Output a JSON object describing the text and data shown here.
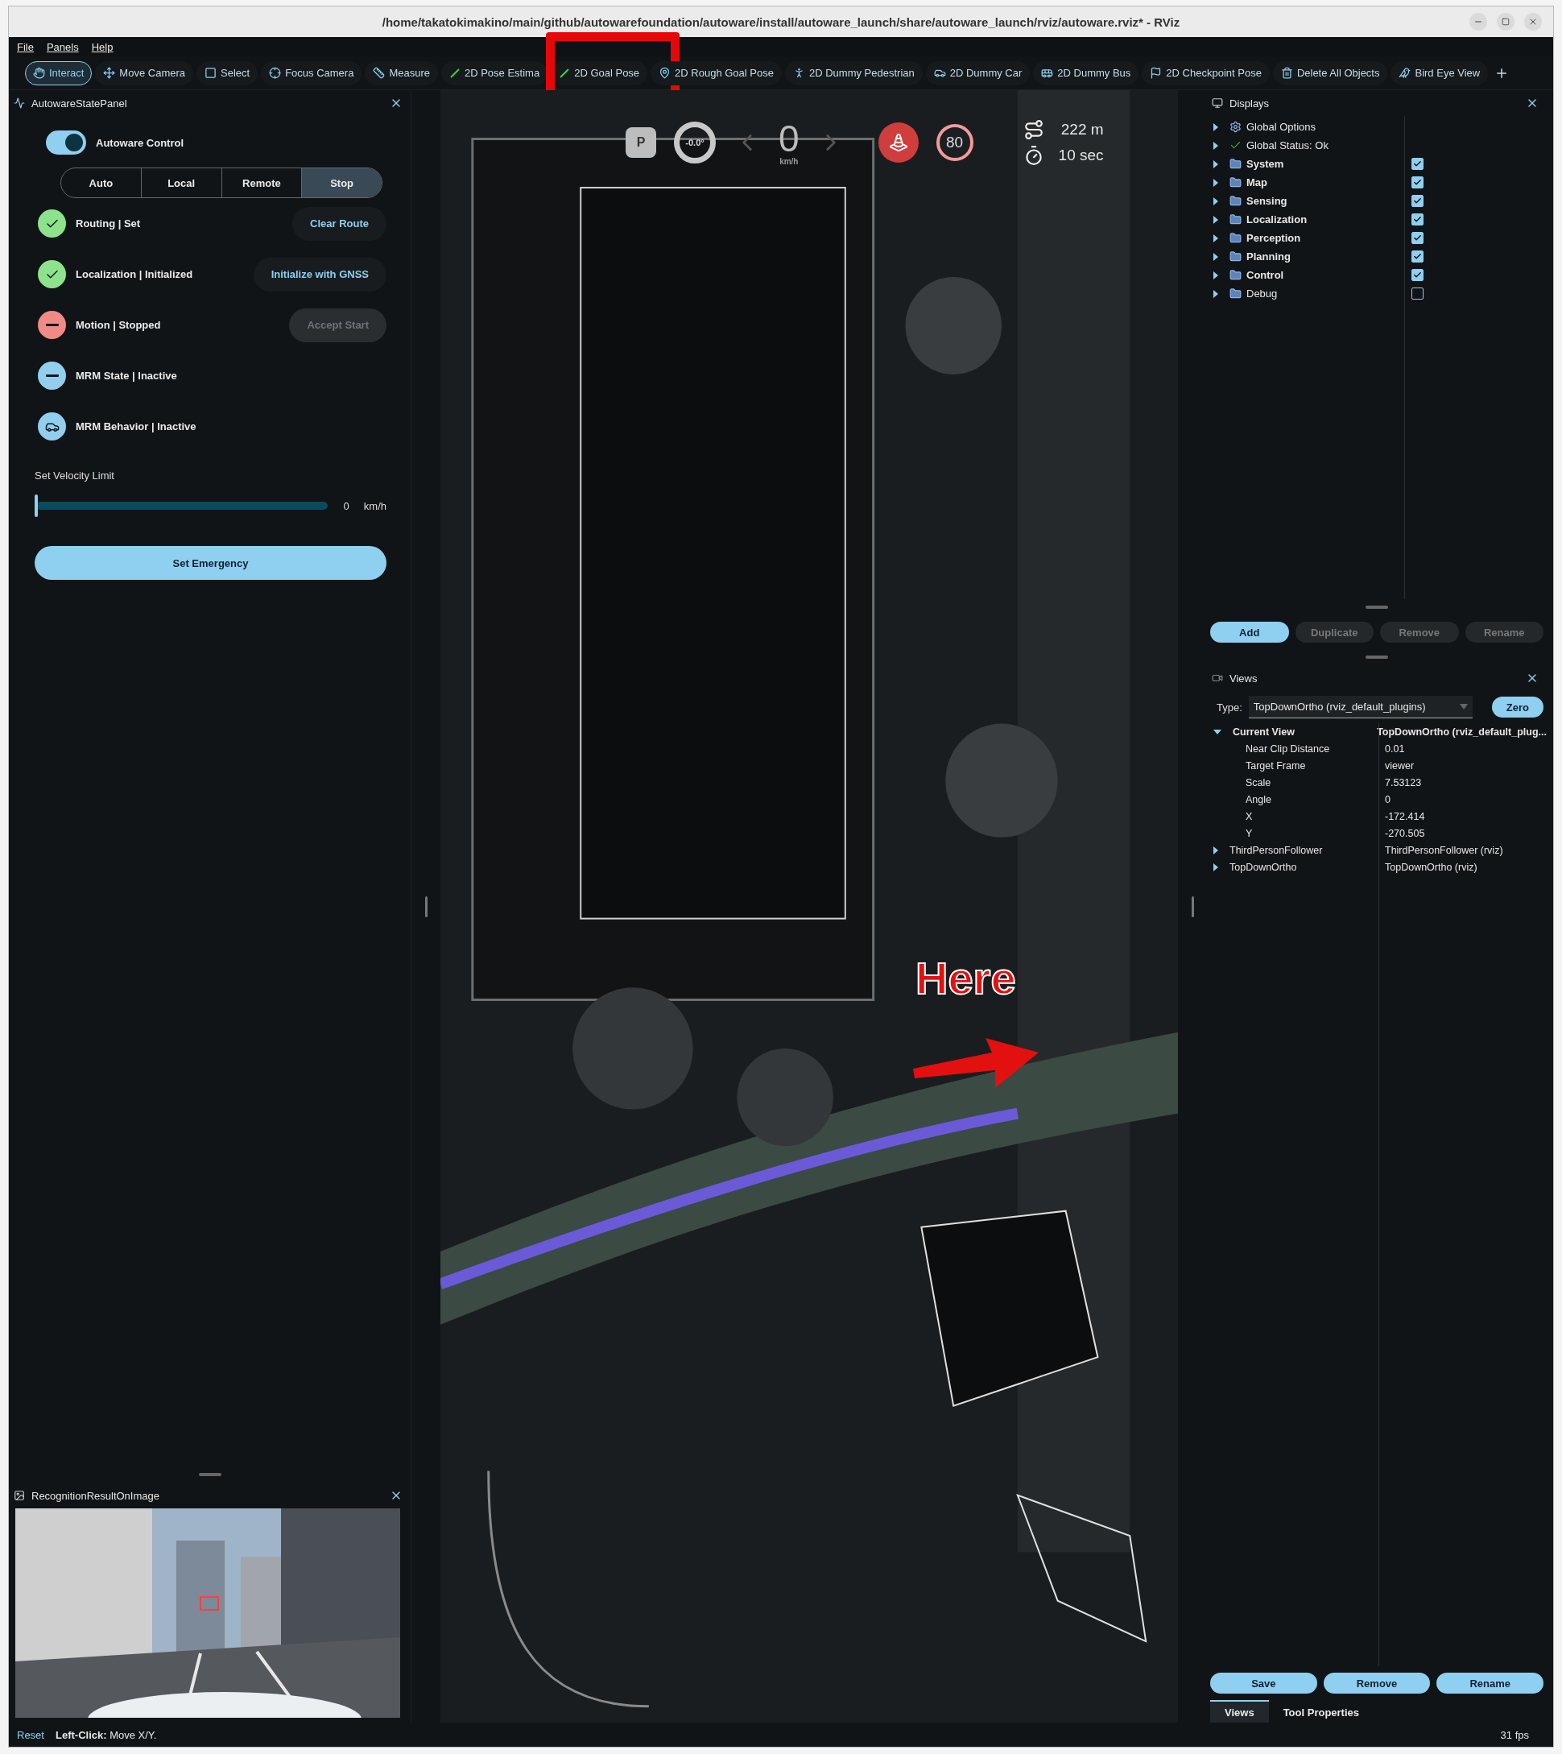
{
  "window": {
    "title": "/home/takatokimakino/main/github/autowarefoundation/autoware/install/autoware_launch/share/autoware_launch/rviz/autoware.rviz* - RViz"
  },
  "menu": [
    "File",
    "Panels",
    "Help"
  ],
  "toolbar": {
    "tools": [
      {
        "label": "Interact",
        "selected": true,
        "highlighted": false
      },
      {
        "label": "Move Camera",
        "selected": false,
        "highlighted": false
      },
      {
        "label": "Select",
        "selected": false,
        "highlighted": false
      },
      {
        "label": "Focus Camera",
        "selected": false,
        "highlighted": false
      },
      {
        "label": "Measure",
        "selected": false,
        "highlighted": false
      },
      {
        "label": "2D Pose Estima",
        "selected": false,
        "highlighted": false
      },
      {
        "label": "2D Goal Pose",
        "selected": false,
        "highlighted": true
      },
      {
        "label": "2D Rough Goal Pose",
        "selected": false,
        "highlighted": false
      },
      {
        "label": "2D Dummy Pedestrian",
        "selected": false,
        "highlighted": false
      },
      {
        "label": "2D Dummy Car",
        "selected": false,
        "highlighted": false
      },
      {
        "label": "2D Dummy Bus",
        "selected": false,
        "highlighted": false
      },
      {
        "label": "2D Checkpoint Pose",
        "selected": false,
        "highlighted": false
      },
      {
        "label": "Delete All Objects",
        "selected": false,
        "highlighted": false
      },
      {
        "label": "Bird Eye View",
        "selected": false,
        "highlighted": false
      }
    ]
  },
  "state_panel": {
    "title": "AutowareStatePanel",
    "control": {
      "label": "Autoware Control",
      "on": true
    },
    "modes": [
      {
        "label": "Auto",
        "selected": false
      },
      {
        "label": "Local",
        "selected": false
      },
      {
        "label": "Remote",
        "selected": false
      },
      {
        "label": "Stop",
        "selected": true
      }
    ],
    "statuses": [
      {
        "label": "Routing | Set",
        "kind": "ok",
        "action": {
          "label": "Clear Route",
          "disabled": false
        }
      },
      {
        "label": "Localization | Initialized",
        "kind": "ok",
        "action": {
          "label": "Initialize with GNSS",
          "disabled": false
        }
      },
      {
        "label": "Motion | Stopped",
        "kind": "stopped",
        "action": {
          "label": "Accept Start",
          "disabled": true
        }
      },
      {
        "label": "MRM State | Inactive",
        "kind": "inactive"
      },
      {
        "label": "MRM Behavior | Inactive",
        "kind": "vehicle"
      }
    ],
    "velocity": {
      "label": "Set Velocity Limit",
      "level": 0,
      "reading": "0",
      "unit": "km/h"
    },
    "emergency_button": "Set Emergency"
  },
  "recognition_panel": {
    "title": "RecognitionResultOnImage"
  },
  "hud": {
    "gear": "P",
    "steering": "-0.0°",
    "speed": "0",
    "speed_unit": "km/h",
    "speed_limit": "80",
    "distance": "222 m",
    "time": "10 sec"
  },
  "annotation": {
    "label": "Here"
  },
  "displays": {
    "title": "Displays",
    "items": [
      {
        "label": "Global Options",
        "kind": "options"
      },
      {
        "label": "Global Status: Ok",
        "kind": "status"
      },
      {
        "label": "System",
        "kind": "folder",
        "checked": true
      },
      {
        "label": "Map",
        "kind": "folder",
        "checked": true
      },
      {
        "label": "Sensing",
        "kind": "folder",
        "checked": true
      },
      {
        "label": "Localization",
        "kind": "folder",
        "checked": true
      },
      {
        "label": "Perception",
        "kind": "folder",
        "checked": true
      },
      {
        "label": "Planning",
        "kind": "folder",
        "checked": true
      },
      {
        "label": "Control",
        "kind": "folder",
        "checked": true
      },
      {
        "label": "Debug",
        "kind": "folder",
        "checked": false
      }
    ],
    "buttons": [
      {
        "label": "Add",
        "disabled": false
      },
      {
        "label": "Duplicate",
        "disabled": true
      },
      {
        "label": "Remove",
        "disabled": true
      },
      {
        "label": "Rename",
        "disabled": true
      }
    ]
  },
  "views": {
    "title": "Views",
    "type_label": "Type:",
    "type_value": "TopDownOrtho (rviz_default_plugins)",
    "zero_button": "Zero",
    "tree": [
      {
        "name": "Current View",
        "value": "TopDownOrtho (rviz_default_plug...",
        "expanded": true,
        "children": [
          {
            "name": "Near Clip Distance",
            "value": "0.01"
          },
          {
            "name": "Target Frame",
            "value": "viewer"
          },
          {
            "name": "Scale",
            "value": "7.53123"
          },
          {
            "name": "Angle",
            "value": "0"
          },
          {
            "name": "X",
            "value": "-172.414"
          },
          {
            "name": "Y",
            "value": "-270.505"
          }
        ]
      },
      {
        "name": "ThirdPersonFollower",
        "value": "ThirdPersonFollower (rviz)",
        "expanded": false
      },
      {
        "name": "TopDownOrtho",
        "value": "TopDownOrtho (rviz)",
        "expanded": false
      }
    ],
    "buttons": [
      "Save",
      "Remove",
      "Rename"
    ],
    "tabs": [
      {
        "label": "Views",
        "selected": true
      },
      {
        "label": "Tool Properties",
        "selected": false
      }
    ]
  },
  "status_bar": {
    "reset": "Reset",
    "hint": "**Left-Click:** Move X/Y.",
    "fps": "31 fps"
  }
}
